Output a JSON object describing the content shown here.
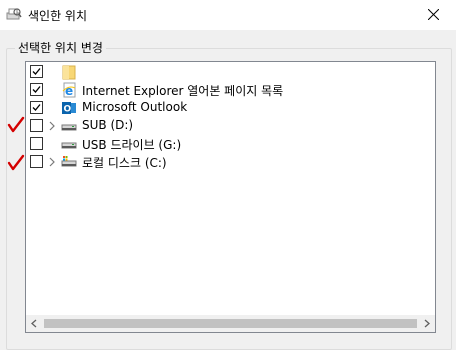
{
  "window": {
    "title": "색인한 위치",
    "title_icon": "search-printer-icon",
    "close_icon": "close-icon"
  },
  "group": {
    "label": "선택한 위치 변경"
  },
  "tree": {
    "items": [
      {
        "label": "",
        "checked": true,
        "expandable": false,
        "icon": "folder-icon"
      },
      {
        "label": "Internet Explorer 열어본 페이지 목록",
        "checked": true,
        "expandable": false,
        "icon": "internet-explorer-icon"
      },
      {
        "label": "Microsoft Outlook",
        "checked": true,
        "expandable": false,
        "icon": "outlook-icon"
      },
      {
        "label": "SUB (D:)",
        "checked": false,
        "expandable": true,
        "icon": "drive-icon"
      },
      {
        "label": "USB 드라이브 (G:)",
        "checked": false,
        "expandable": false,
        "icon": "drive-icon"
      },
      {
        "label": "로컬 디스크 (C:)",
        "checked": false,
        "expandable": true,
        "icon": "system-drive-icon"
      }
    ]
  },
  "annotations": {
    "color": "#d40000",
    "marks": [
      "checkmark-annotation-icon",
      "checkmark-annotation-icon"
    ]
  },
  "colors": {
    "ie_blue": "#1e88e5",
    "outlook_blue": "#0a64ad",
    "folder_yellow": "#f8d775"
  }
}
